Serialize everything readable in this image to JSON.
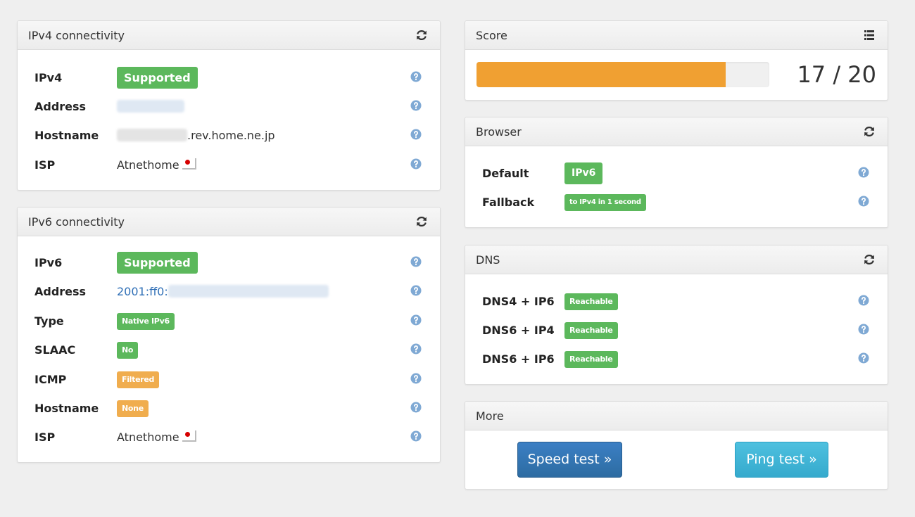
{
  "ipv4": {
    "title": "IPv4 connectivity",
    "rows": {
      "ipv4": {
        "label": "IPv4",
        "badge": "Supported"
      },
      "address": {
        "label": "Address"
      },
      "hostname": {
        "label": "Hostname",
        "suffix": ".rev.home.ne.jp"
      },
      "isp": {
        "label": "ISP",
        "value": "Atnethome"
      }
    }
  },
  "ipv6": {
    "title": "IPv6 connectivity",
    "rows": {
      "ipv6": {
        "label": "IPv6",
        "badge": "Supported"
      },
      "address": {
        "label": "Address",
        "prefix": "2001:ff0:"
      },
      "type": {
        "label": "Type",
        "badge": "Native IPv6"
      },
      "slaac": {
        "label": "SLAAC",
        "badge": "No"
      },
      "icmp": {
        "label": "ICMP",
        "badge": "Filtered"
      },
      "hostname": {
        "label": "Hostname",
        "badge": "None"
      },
      "isp": {
        "label": "ISP",
        "value": "Atnethome"
      }
    }
  },
  "score": {
    "title": "Score",
    "text": "17 / 20",
    "value": 17,
    "max": 20
  },
  "browser": {
    "title": "Browser",
    "rows": {
      "default": {
        "label": "Default",
        "badge": "IPv6"
      },
      "fallback": {
        "label": "Fallback",
        "badge": "to IPv4 in 1 second"
      }
    }
  },
  "dns": {
    "title": "DNS",
    "rows": {
      "dns4_ip6": {
        "label": "DNS4 + IP6",
        "badge": "Reachable"
      },
      "dns6_ip4": {
        "label": "DNS6 + IP4",
        "badge": "Reachable"
      },
      "dns6_ip6": {
        "label": "DNS6 + IP6",
        "badge": "Reachable"
      }
    }
  },
  "more": {
    "title": "More",
    "speed_test": "Speed test »",
    "ping_test": "Ping test »"
  },
  "colors": {
    "success": "#5cb85c",
    "warning": "#f0ad4e",
    "progress": "#f0a032",
    "help_icon": "#7fa9d4"
  },
  "icons": [
    "refresh-icon",
    "list-icon",
    "help-icon",
    "flag-japan-icon"
  ]
}
